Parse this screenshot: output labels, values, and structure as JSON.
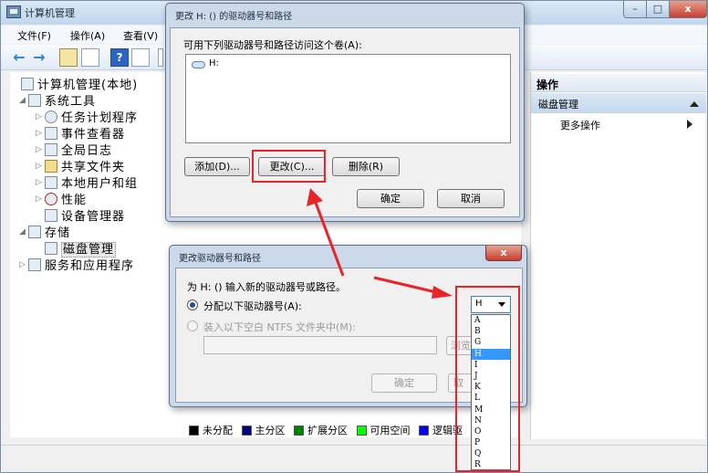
{
  "main_window": {
    "title": "计算机管理",
    "min": "–",
    "max": "□",
    "close": "x",
    "menu": [
      "文件(F)",
      "操作(A)",
      "查看(V)"
    ],
    "help_icon": "?"
  },
  "tree": [
    {
      "label": "计算机管理(本地)",
      "icon": "computer-icon",
      "expander": ""
    },
    {
      "label": "系统工具",
      "icon": "tools-icon",
      "expander": "◢"
    },
    {
      "label": "任务计划程序",
      "icon": "clock-icon",
      "expander": "▷"
    },
    {
      "label": "事件查看器",
      "icon": "event-viewer-icon",
      "expander": "▷"
    },
    {
      "label": "全局日志",
      "icon": "log-icon",
      "expander": "▷"
    },
    {
      "label": "共享文件夹",
      "icon": "shared-folder-icon",
      "expander": "▷"
    },
    {
      "label": "本地用户和组",
      "icon": "users-icon",
      "expander": "▷"
    },
    {
      "label": "性能",
      "icon": "performance-icon",
      "expander": "▷"
    },
    {
      "label": "设备管理器",
      "icon": "device-manager-icon",
      "expander": ""
    },
    {
      "label": "存储",
      "icon": "storage-icon",
      "expander": "◢"
    },
    {
      "label": "磁盘管理",
      "icon": "disk-icon",
      "expander": ""
    },
    {
      "label": "服务和应用程序",
      "icon": "services-icon",
      "expander": "▷"
    }
  ],
  "actions": {
    "header": "操作",
    "section": "磁盘管理",
    "more": "更多操作"
  },
  "legend": [
    {
      "label": "未分配",
      "color": "#000000"
    },
    {
      "label": "主分区",
      "color": "#000080"
    },
    {
      "label": "扩展分区",
      "color": "#008000"
    },
    {
      "label": "可用空间",
      "color": "#00ff00"
    },
    {
      "label": "逻辑驱",
      "color": "#0000ff"
    }
  ],
  "dialog1": {
    "title": "更改 H: () 的驱动器号和路径",
    "instruction": "可用下列驱动器号和路径访问这个卷(A):",
    "list_item": "H:",
    "add": "添加(D)...",
    "change": "更改(C)...",
    "delete": "删除(R)",
    "ok": "确定",
    "cancel": "取消"
  },
  "dialog2": {
    "title": "更改驱动器号和路径",
    "close": "x",
    "prompt": "为 H: () 输入新的驱动器号或路径。",
    "option_assign": "分配以下驱动器号(A):",
    "option_mount": "装入以下空白 NTFS 文件夹中(M):",
    "browse": "浏览",
    "ok": "确定",
    "cancel_partial": "取",
    "selected_letter": "H",
    "letters": [
      "A",
      "B",
      "G",
      "H",
      "I",
      "J",
      "K",
      "L",
      "M",
      "N",
      "O",
      "P",
      "Q",
      "R"
    ],
    "highlighted": "H"
  },
  "colors": {
    "highlight_border": "#e8242a",
    "selection": "#3399ff"
  }
}
